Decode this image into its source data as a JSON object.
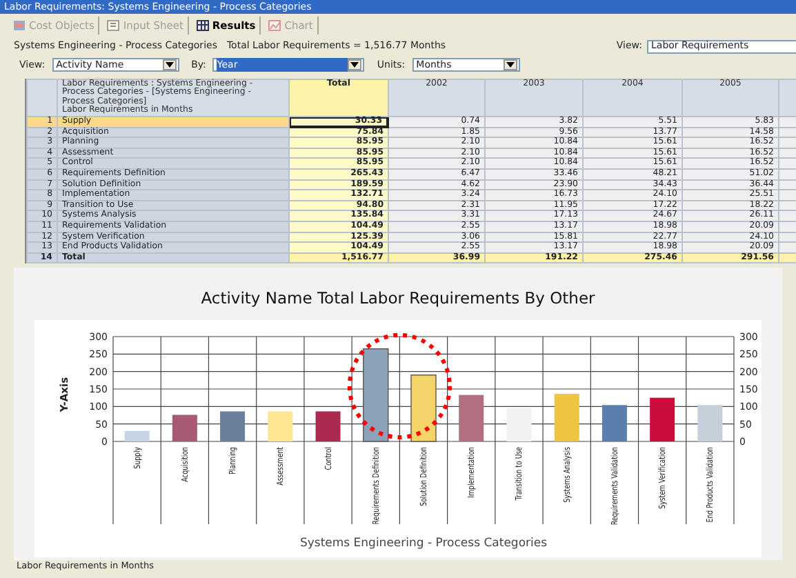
{
  "window": {
    "title": "Labor Requirements: Systems Engineering - Process Categories"
  },
  "toolbar": [
    {
      "label": "Cost Objects",
      "kind": "cube",
      "selected": false,
      "disabled": true
    },
    {
      "label": "Input Sheet",
      "kind": "sheet",
      "selected": false,
      "disabled": true
    },
    {
      "label": "Results",
      "kind": "grid",
      "selected": true,
      "disabled": false
    },
    {
      "label": "Chart",
      "kind": "chart",
      "selected": false,
      "disabled": true
    }
  ],
  "summary": {
    "title": "Systems Engineering - Process Categories",
    "total": "Total Labor Requirements = 1,516.77 Months",
    "view_label": "View:",
    "view_value": "Labor Requirements"
  },
  "filters": [
    {
      "label": "View:",
      "value": "Activity Name",
      "highlighted": false
    },
    {
      "label": "By:",
      "value": "Year",
      "highlighted": true
    },
    {
      "label": "Units:",
      "value": "Months",
      "highlighted": false
    }
  ],
  "table": {
    "header_title": "Labor Requirements : Systems Engineering - Process Categories - [Systems Engineering - Process Categories]",
    "header_units": "Labor Requirements in Months",
    "columns": [
      "Total",
      "2002",
      "2003",
      "2004",
      "2005"
    ],
    "rows": [
      {
        "index": "1",
        "name": "Supply",
        "kind": "item",
        "selected": true,
        "values": [
          "30.33",
          "0.74",
          "3.82",
          "5.51",
          "5.83"
        ]
      },
      {
        "index": "2",
        "name": "Acquisition",
        "kind": "item",
        "selected": false,
        "values": [
          "75.84",
          "1.85",
          "9.56",
          "13.77",
          "14.58"
        ]
      },
      {
        "index": "3",
        "name": "Planning",
        "kind": "item",
        "selected": false,
        "values": [
          "85.95",
          "2.10",
          "10.84",
          "15.61",
          "16.52"
        ]
      },
      {
        "index": "4",
        "name": "Assessment",
        "kind": "item",
        "selected": false,
        "values": [
          "85.95",
          "2.10",
          "10.84",
          "15.61",
          "16.52"
        ]
      },
      {
        "index": "5",
        "name": "Control",
        "kind": "item",
        "selected": false,
        "values": [
          "85.95",
          "2.10",
          "10.84",
          "15.61",
          "16.52"
        ]
      },
      {
        "index": "6",
        "name": "Requirements Definition",
        "kind": "item",
        "selected": false,
        "values": [
          "265.43",
          "6.47",
          "33.46",
          "48.21",
          "51.02"
        ]
      },
      {
        "index": "7",
        "name": "Solution Definition",
        "kind": "item",
        "selected": false,
        "values": [
          "189.59",
          "4.62",
          "23.90",
          "34.43",
          "36.44"
        ]
      },
      {
        "index": "8",
        "name": "Implementation",
        "kind": "item",
        "selected": false,
        "values": [
          "132.71",
          "3.24",
          "16.73",
          "24.10",
          "25.51"
        ]
      },
      {
        "index": "9",
        "name": "Transition to Use",
        "kind": "item",
        "selected": false,
        "values": [
          "94.80",
          "2.31",
          "11.95",
          "17.22",
          "18.22"
        ]
      },
      {
        "index": "10",
        "name": "Systems Analysis",
        "kind": "item",
        "selected": false,
        "values": [
          "135.84",
          "3.31",
          "17.13",
          "24.67",
          "26.11"
        ]
      },
      {
        "index": "11",
        "name": "Requirements Validation",
        "kind": "item",
        "selected": false,
        "values": [
          "104.49",
          "2.55",
          "13.17",
          "18.98",
          "20.09"
        ]
      },
      {
        "index": "12",
        "name": "System Verification",
        "kind": "item",
        "selected": false,
        "values": [
          "125.39",
          "3.06",
          "15.81",
          "22.77",
          "24.10"
        ]
      },
      {
        "index": "13",
        "name": "End Products Validation",
        "kind": "item",
        "selected": false,
        "values": [
          "104.49",
          "2.55",
          "13.17",
          "18.98",
          "20.09"
        ]
      },
      {
        "index": "14",
        "name": "Total",
        "kind": "total",
        "selected": false,
        "values": [
          "1,516.77",
          "36.99",
          "191.22",
          "275.46",
          "291.56"
        ]
      }
    ]
  },
  "chart": {
    "chart_data": {
      "type": "bar",
      "title": "Activity Name Total Labor Requirements By Other",
      "xlabel": "Systems Engineering - Process Categories",
      "ylabel": "Y-Axis",
      "categories": [
        "Supply",
        "Acquisition",
        "Planning",
        "Assessment",
        "Control",
        "Requirements Definition",
        "Solution Definition",
        "Implementation",
        "Transition to Use",
        "Systems Analysis",
        "Requirements Validation",
        "System Verification",
        "End Products Validation"
      ],
      "series": [
        {
          "values": [
            30,
            76,
            86,
            86,
            86,
            265,
            190,
            133,
            95,
            136,
            104,
            125,
            104
          ]
        }
      ],
      "ylim": [
        0,
        300
      ],
      "yticks": [
        {
          "value": 0,
          "label": "0"
        },
        {
          "value": 50,
          "label": "50"
        },
        {
          "value": 100,
          "label": "100"
        },
        {
          "value": 150,
          "label": "150"
        },
        {
          "value": 200,
          "label": "200"
        },
        {
          "value": 250,
          "label": "250"
        },
        {
          "value": 300,
          "label": "300"
        }
      ],
      "grid": true
    },
    "bars": [
      {
        "color": "#c5d5e6",
        "highlighted": false
      },
      {
        "color": "#a85a72",
        "highlighted": false
      },
      {
        "color": "#6a809c",
        "highlighted": false
      },
      {
        "color": "#fde591",
        "highlighted": false
      },
      {
        "color": "#aa2a50",
        "highlighted": false
      },
      {
        "color": "#8da2b8",
        "highlighted": true
      },
      {
        "color": "#f5d56a",
        "highlighted": true
      },
      {
        "color": "#b07080",
        "highlighted": false
      },
      {
        "color": "#f2f2f2",
        "highlighted": false
      },
      {
        "color": "#eec540",
        "highlighted": false
      },
      {
        "color": "#5b7fad",
        "highlighted": false
      },
      {
        "color": "#cc0c3a",
        "highlighted": false
      },
      {
        "color": "#c6d0da",
        "highlighted": false
      }
    ],
    "right_axis_ticks": [
      "300",
      "250",
      "200",
      "150",
      "100",
      "50",
      "0"
    ]
  },
  "status_bar": {
    "text": "Labor Requirements in Months"
  }
}
